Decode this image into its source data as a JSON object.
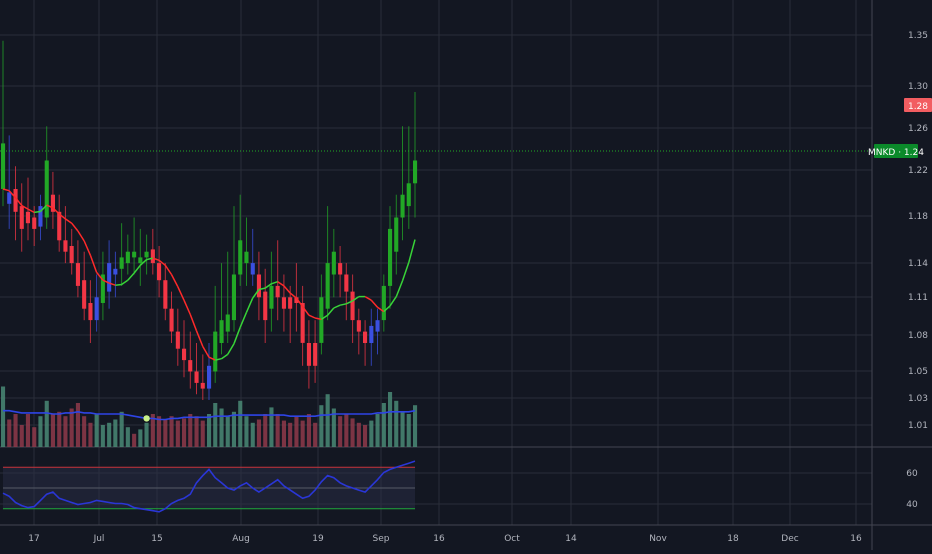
{
  "symbol": "MNKD",
  "last_price": "1.24",
  "price_badge_label": "MNKD · 1.24",
  "marker_badge_label": "1.28",
  "colors": {
    "background": "#131722",
    "grid": "#2a2e39",
    "up": "#22a826",
    "down": "#f23645",
    "neutral": "#3a4fe0",
    "ma": "#ff2a2a",
    "ma_up": "#38d438",
    "volume_up": "#4a8a76",
    "volume_down": "#8f3a4a",
    "volume_ma": "#2e44e6",
    "badge_green": "#0b8a2a",
    "badge_red": "#f25d61",
    "rsi_line": "#2a36d6",
    "rsi_upper": "#c8323a",
    "rsi_lower": "#1ea83a",
    "text": "#b2b5be"
  },
  "chart_data": {
    "type": "candlestick",
    "price_axis_ticks": [
      "1.35",
      "1.30",
      "1.26",
      "1.22",
      "1.18",
      "1.14",
      "1.11",
      "1.08",
      "1.05",
      "1.03",
      "1.01"
    ],
    "rsi_axis_ticks": [
      "60",
      "40"
    ],
    "time_axis_ticks": [
      "17",
      "Jul",
      "15",
      "Aug",
      "19",
      "Sep",
      "16",
      "Oct",
      "14",
      "Nov",
      "18",
      "Dec",
      "16"
    ],
    "candles": [
      {
        "o": 1.255,
        "h": 1.345,
        "l": 1.2,
        "c": 1.215,
        "dir": "up"
      },
      {
        "o": 1.202,
        "h": 1.262,
        "l": 1.18,
        "c": 1.212,
        "dir": "neutral"
      },
      {
        "o": 1.215,
        "h": 1.235,
        "l": 1.17,
        "c": 1.195,
        "dir": "down"
      },
      {
        "o": 1.2,
        "h": 1.22,
        "l": 1.16,
        "c": 1.18,
        "dir": "down"
      },
      {
        "o": 1.195,
        "h": 1.225,
        "l": 1.17,
        "c": 1.185,
        "dir": "down"
      },
      {
        "o": 1.19,
        "h": 1.2,
        "l": 1.165,
        "c": 1.18,
        "dir": "down"
      },
      {
        "o": 1.182,
        "h": 1.21,
        "l": 1.17,
        "c": 1.2,
        "dir": "neutral"
      },
      {
        "o": 1.19,
        "h": 1.27,
        "l": 1.18,
        "c": 1.24,
        "dir": "up"
      },
      {
        "o": 1.21,
        "h": 1.23,
        "l": 1.18,
        "c": 1.195,
        "dir": "down"
      },
      {
        "o": 1.195,
        "h": 1.21,
        "l": 1.16,
        "c": 1.17,
        "dir": "down"
      },
      {
        "o": 1.17,
        "h": 1.2,
        "l": 1.15,
        "c": 1.16,
        "dir": "down"
      },
      {
        "o": 1.165,
        "h": 1.18,
        "l": 1.14,
        "c": 1.15,
        "dir": "down"
      },
      {
        "o": 1.15,
        "h": 1.17,
        "l": 1.12,
        "c": 1.13,
        "dir": "down"
      },
      {
        "o": 1.135,
        "h": 1.16,
        "l": 1.1,
        "c": 1.11,
        "dir": "down"
      },
      {
        "o": 1.115,
        "h": 1.135,
        "l": 1.08,
        "c": 1.1,
        "dir": "down"
      },
      {
        "o": 1.1,
        "h": 1.14,
        "l": 1.09,
        "c": 1.12,
        "dir": "neutral"
      },
      {
        "o": 1.115,
        "h": 1.16,
        "l": 1.1,
        "c": 1.14,
        "dir": "up"
      },
      {
        "o": 1.125,
        "h": 1.17,
        "l": 1.11,
        "c": 1.15,
        "dir": "neutral"
      },
      {
        "o": 1.14,
        "h": 1.16,
        "l": 1.12,
        "c": 1.145,
        "dir": "neutral"
      },
      {
        "o": 1.145,
        "h": 1.185,
        "l": 1.13,
        "c": 1.155,
        "dir": "up"
      },
      {
        "o": 1.15,
        "h": 1.175,
        "l": 1.14,
        "c": 1.16,
        "dir": "up"
      },
      {
        "o": 1.155,
        "h": 1.19,
        "l": 1.14,
        "c": 1.16,
        "dir": "up"
      },
      {
        "o": 1.15,
        "h": 1.18,
        "l": 1.13,
        "c": 1.155,
        "dir": "up"
      },
      {
        "o": 1.155,
        "h": 1.175,
        "l": 1.14,
        "c": 1.16,
        "dir": "up"
      },
      {
        "o": 1.162,
        "h": 1.18,
        "l": 1.14,
        "c": 1.15,
        "dir": "down"
      },
      {
        "o": 1.15,
        "h": 1.165,
        "l": 1.12,
        "c": 1.135,
        "dir": "down"
      },
      {
        "o": 1.135,
        "h": 1.15,
        "l": 1.1,
        "c": 1.11,
        "dir": "down"
      },
      {
        "o": 1.11,
        "h": 1.125,
        "l": 1.08,
        "c": 1.09,
        "dir": "down"
      },
      {
        "o": 1.09,
        "h": 1.11,
        "l": 1.06,
        "c": 1.075,
        "dir": "down"
      },
      {
        "o": 1.075,
        "h": 1.1,
        "l": 1.05,
        "c": 1.065,
        "dir": "down"
      },
      {
        "o": 1.065,
        "h": 1.09,
        "l": 1.04,
        "c": 1.055,
        "dir": "down"
      },
      {
        "o": 1.055,
        "h": 1.08,
        "l": 1.035,
        "c": 1.045,
        "dir": "down"
      },
      {
        "o": 1.045,
        "h": 1.07,
        "l": 1.03,
        "c": 1.04,
        "dir": "down"
      },
      {
        "o": 1.04,
        "h": 1.08,
        "l": 1.03,
        "c": 1.06,
        "dir": "neutral"
      },
      {
        "o": 1.055,
        "h": 1.13,
        "l": 1.045,
        "c": 1.09,
        "dir": "up"
      },
      {
        "o": 1.08,
        "h": 1.15,
        "l": 1.07,
        "c": 1.1,
        "dir": "up"
      },
      {
        "o": 1.09,
        "h": 1.16,
        "l": 1.08,
        "c": 1.105,
        "dir": "up"
      },
      {
        "o": 1.1,
        "h": 1.2,
        "l": 1.09,
        "c": 1.14,
        "dir": "up"
      },
      {
        "o": 1.14,
        "h": 1.21,
        "l": 1.13,
        "c": 1.17,
        "dir": "up"
      },
      {
        "o": 1.16,
        "h": 1.19,
        "l": 1.13,
        "c": 1.15,
        "dir": "up"
      },
      {
        "o": 1.15,
        "h": 1.18,
        "l": 1.13,
        "c": 1.14,
        "dir": "neutral"
      },
      {
        "o": 1.14,
        "h": 1.16,
        "l": 1.1,
        "c": 1.12,
        "dir": "down"
      },
      {
        "o": 1.125,
        "h": 1.145,
        "l": 1.08,
        "c": 1.1,
        "dir": "down"
      },
      {
        "o": 1.11,
        "h": 1.16,
        "l": 1.09,
        "c": 1.13,
        "dir": "up"
      },
      {
        "o": 1.13,
        "h": 1.17,
        "l": 1.1,
        "c": 1.12,
        "dir": "down"
      },
      {
        "o": 1.12,
        "h": 1.14,
        "l": 1.09,
        "c": 1.11,
        "dir": "down"
      },
      {
        "o": 1.11,
        "h": 1.13,
        "l": 1.08,
        "c": 1.12,
        "dir": "down"
      },
      {
        "o": 1.12,
        "h": 1.15,
        "l": 1.09,
        "c": 1.115,
        "dir": "down"
      },
      {
        "o": 1.115,
        "h": 1.13,
        "l": 1.06,
        "c": 1.08,
        "dir": "down"
      },
      {
        "o": 1.08,
        "h": 1.1,
        "l": 1.04,
        "c": 1.06,
        "dir": "down"
      },
      {
        "o": 1.06,
        "h": 1.1,
        "l": 1.045,
        "c": 1.08,
        "dir": "down"
      },
      {
        "o": 1.08,
        "h": 1.14,
        "l": 1.07,
        "c": 1.12,
        "dir": "up"
      },
      {
        "o": 1.11,
        "h": 1.2,
        "l": 1.1,
        "c": 1.15,
        "dir": "up"
      },
      {
        "o": 1.14,
        "h": 1.18,
        "l": 1.12,
        "c": 1.16,
        "dir": "up"
      },
      {
        "o": 1.15,
        "h": 1.165,
        "l": 1.12,
        "c": 1.14,
        "dir": "down"
      },
      {
        "o": 1.14,
        "h": 1.15,
        "l": 1.1,
        "c": 1.125,
        "dir": "down"
      },
      {
        "o": 1.125,
        "h": 1.14,
        "l": 1.08,
        "c": 1.1,
        "dir": "down"
      },
      {
        "o": 1.1,
        "h": 1.11,
        "l": 1.07,
        "c": 1.09,
        "dir": "down"
      },
      {
        "o": 1.09,
        "h": 1.1,
        "l": 1.06,
        "c": 1.08,
        "dir": "down"
      },
      {
        "o": 1.08,
        "h": 1.11,
        "l": 1.06,
        "c": 1.095,
        "dir": "neutral"
      },
      {
        "o": 1.09,
        "h": 1.11,
        "l": 1.07,
        "c": 1.1,
        "dir": "neutral"
      },
      {
        "o": 1.1,
        "h": 1.14,
        "l": 1.09,
        "c": 1.13,
        "dir": "up"
      },
      {
        "o": 1.13,
        "h": 1.2,
        "l": 1.11,
        "c": 1.18,
        "dir": "up"
      },
      {
        "o": 1.16,
        "h": 1.21,
        "l": 1.14,
        "c": 1.19,
        "dir": "up"
      },
      {
        "o": 1.19,
        "h": 1.27,
        "l": 1.17,
        "c": 1.21,
        "dir": "up"
      },
      {
        "o": 1.2,
        "h": 1.27,
        "l": 1.18,
        "c": 1.22,
        "dir": "up"
      },
      {
        "o": 1.22,
        "h": 1.3,
        "l": 1.19,
        "c": 1.24,
        "dir": "up"
      }
    ],
    "volume": [
      {
        "v": 0.55,
        "dir": "up"
      },
      {
        "v": 0.25,
        "dir": "down"
      },
      {
        "v": 0.3,
        "dir": "down"
      },
      {
        "v": 0.2,
        "dir": "down"
      },
      {
        "v": 0.3,
        "dir": "down"
      },
      {
        "v": 0.18,
        "dir": "down"
      },
      {
        "v": 0.28,
        "dir": "up"
      },
      {
        "v": 0.42,
        "dir": "up"
      },
      {
        "v": 0.3,
        "dir": "down"
      },
      {
        "v": 0.32,
        "dir": "down"
      },
      {
        "v": 0.28,
        "dir": "down"
      },
      {
        "v": 0.35,
        "dir": "down"
      },
      {
        "v": 0.4,
        "dir": "down"
      },
      {
        "v": 0.28,
        "dir": "down"
      },
      {
        "v": 0.22,
        "dir": "down"
      },
      {
        "v": 0.3,
        "dir": "up"
      },
      {
        "v": 0.2,
        "dir": "up"
      },
      {
        "v": 0.22,
        "dir": "up"
      },
      {
        "v": 0.25,
        "dir": "up"
      },
      {
        "v": 0.32,
        "dir": "up"
      },
      {
        "v": 0.18,
        "dir": "up"
      },
      {
        "v": 0.12,
        "dir": "down"
      },
      {
        "v": 0.16,
        "dir": "up"
      },
      {
        "v": 0.22,
        "dir": "up"
      },
      {
        "v": 0.3,
        "dir": "down"
      },
      {
        "v": 0.28,
        "dir": "down"
      },
      {
        "v": 0.25,
        "dir": "down"
      },
      {
        "v": 0.28,
        "dir": "down"
      },
      {
        "v": 0.24,
        "dir": "down"
      },
      {
        "v": 0.26,
        "dir": "down"
      },
      {
        "v": 0.3,
        "dir": "down"
      },
      {
        "v": 0.28,
        "dir": "down"
      },
      {
        "v": 0.24,
        "dir": "down"
      },
      {
        "v": 0.3,
        "dir": "up"
      },
      {
        "v": 0.4,
        "dir": "up"
      },
      {
        "v": 0.35,
        "dir": "up"
      },
      {
        "v": 0.28,
        "dir": "up"
      },
      {
        "v": 0.32,
        "dir": "up"
      },
      {
        "v": 0.42,
        "dir": "up"
      },
      {
        "v": 0.28,
        "dir": "up"
      },
      {
        "v": 0.22,
        "dir": "up"
      },
      {
        "v": 0.25,
        "dir": "down"
      },
      {
        "v": 0.3,
        "dir": "down"
      },
      {
        "v": 0.36,
        "dir": "up"
      },
      {
        "v": 0.3,
        "dir": "down"
      },
      {
        "v": 0.24,
        "dir": "down"
      },
      {
        "v": 0.22,
        "dir": "down"
      },
      {
        "v": 0.28,
        "dir": "down"
      },
      {
        "v": 0.24,
        "dir": "down"
      },
      {
        "v": 0.3,
        "dir": "down"
      },
      {
        "v": 0.22,
        "dir": "down"
      },
      {
        "v": 0.38,
        "dir": "up"
      },
      {
        "v": 0.48,
        "dir": "up"
      },
      {
        "v": 0.35,
        "dir": "up"
      },
      {
        "v": 0.28,
        "dir": "down"
      },
      {
        "v": 0.3,
        "dir": "down"
      },
      {
        "v": 0.26,
        "dir": "down"
      },
      {
        "v": 0.22,
        "dir": "down"
      },
      {
        "v": 0.2,
        "dir": "down"
      },
      {
        "v": 0.24,
        "dir": "up"
      },
      {
        "v": 0.3,
        "dir": "up"
      },
      {
        "v": 0.4,
        "dir": "up"
      },
      {
        "v": 0.5,
        "dir": "up"
      },
      {
        "v": 0.42,
        "dir": "up"
      },
      {
        "v": 0.32,
        "dir": "up"
      },
      {
        "v": 0.3,
        "dir": "up"
      },
      {
        "v": 0.38,
        "dir": "up"
      }
    ],
    "volume_ma": [
      0.33,
      0.33,
      0.32,
      0.31,
      0.31,
      0.31,
      0.31,
      0.31,
      0.3,
      0.3,
      0.31,
      0.31,
      0.32,
      0.31,
      0.31,
      0.3,
      0.3,
      0.3,
      0.3,
      0.3,
      0.29,
      0.28,
      0.27,
      0.26,
      0.26,
      0.25,
      0.25,
      0.26,
      0.26,
      0.27,
      0.27,
      0.27,
      0.27,
      0.27,
      0.28,
      0.28,
      0.28,
      0.29,
      0.29,
      0.29,
      0.29,
      0.29,
      0.29,
      0.29,
      0.29,
      0.29,
      0.28,
      0.28,
      0.28,
      0.28,
      0.28,
      0.29,
      0.29,
      0.3,
      0.3,
      0.3,
      0.3,
      0.3,
      0.3,
      0.3,
      0.31,
      0.31,
      0.32,
      0.32,
      0.32,
      0.32,
      0.33
    ],
    "rsi": [
      45,
      42,
      36,
      33,
      31,
      32,
      38,
      44,
      46,
      40,
      38,
      36,
      34,
      35,
      36,
      38,
      37,
      36,
      35,
      35,
      34,
      31,
      30,
      29,
      28,
      27,
      30,
      35,
      38,
      40,
      44,
      55,
      62,
      68,
      60,
      55,
      50,
      48,
      52,
      55,
      50,
      46,
      50,
      54,
      58,
      52,
      48,
      44,
      40,
      42,
      48,
      56,
      62,
      60,
      55,
      52,
      50,
      48,
      46,
      52,
      58,
      65,
      68,
      70,
      72,
      74,
      76
    ],
    "rsi_bands": {
      "upper": 70,
      "middle": 50,
      "lower": 30
    }
  }
}
